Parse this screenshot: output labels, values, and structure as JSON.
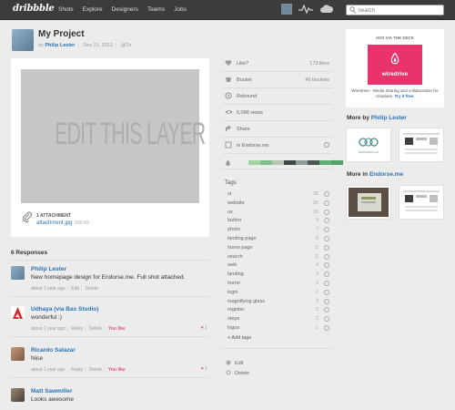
{
  "topbar": {
    "logo": "dribbble",
    "nav": [
      "Shots",
      "Explore",
      "Designers",
      "Teams",
      "Jobs"
    ],
    "search_placeholder": "Search"
  },
  "shot": {
    "title": "My Project",
    "by": "by",
    "author": "Philip Lester",
    "date": "Dec 21, 2012",
    "resolution": "@2x",
    "image_text": "EDIT THIS LAYER",
    "attachment_label": "1 ATTACHMENT",
    "attachment_file": "attachment.jpg",
    "attachment_size": "500 Kb"
  },
  "stats": {
    "like_label": "Like?",
    "likes": "173 likes",
    "bucket_label": "Bucket",
    "buckets": "40 buckets",
    "rebound_label": "Rebound",
    "views": "5,098 views",
    "share_label": "Share",
    "team_label": "in Endorse.me"
  },
  "palette": [
    "#9fd49a",
    "#7ec08a",
    "#b9c6ad",
    "#3f4a44",
    "#8f9c95",
    "#4a5953",
    "#5fae73",
    "#4ea364"
  ],
  "tags_title": "Tags",
  "tags": [
    {
      "name": "ui",
      "count": "36"
    },
    {
      "name": "website",
      "count": "26"
    },
    {
      "name": "ux",
      "count": "15"
    },
    {
      "name": "button",
      "count": "9"
    },
    {
      "name": "photo",
      "count": "7"
    },
    {
      "name": "landing page",
      "count": "6"
    },
    {
      "name": "home page",
      "count": "5"
    },
    {
      "name": "search",
      "count": "5"
    },
    {
      "name": "web",
      "count": "4"
    },
    {
      "name": "landing",
      "count": "3"
    },
    {
      "name": "home",
      "count": "2"
    },
    {
      "name": "login",
      "count": "2"
    },
    {
      "name": "magnifying glass",
      "count": "2"
    },
    {
      "name": "register",
      "count": "2"
    },
    {
      "name": "steps",
      "count": "2"
    },
    {
      "name": "logos",
      "count": "1"
    }
  ],
  "add_tags": "+ Add tags",
  "actions": {
    "edit": "Edit",
    "delete": "Delete"
  },
  "responses_heading": "6 Responses",
  "responses": [
    {
      "name": "Philip Lester",
      "text": "New homepage design for Endorse.me. Full shot attached.",
      "time": "about 1 year ago",
      "links": [
        "Edit",
        "Delete"
      ],
      "you_like": "",
      "likes": ""
    },
    {
      "name": "Udhaya (via Bas Studio)",
      "text": "wonderful :)",
      "time": "about 1 year ago",
      "links": [
        "Reply",
        "Delete"
      ],
      "you_like": "You like",
      "likes": "1"
    },
    {
      "name": "Ricardo Salazar",
      "text": "Nice",
      "time": "about 1 year ago",
      "links": [
        "Reply",
        "Delete"
      ],
      "you_like": "You like",
      "likes": "1"
    },
    {
      "name": "Matt Sawmiller",
      "text": "Looks awesome",
      "time": "",
      "links": [],
      "you_like": "",
      "likes": ""
    }
  ],
  "ad": {
    "title": "ADS VIA THE DECK",
    "brand": "wiredrive",
    "copy": "Wiredrive - Media sharing and collaboration for creatives.",
    "cta": "Try it free."
  },
  "more_by": {
    "prefix": "More",
    "by": "by",
    "name": "Philip Lester",
    "thumb_text": "CROSSVILLE"
  },
  "more_in": {
    "prefix": "More",
    "in": "in",
    "name": "Endorse.me"
  }
}
